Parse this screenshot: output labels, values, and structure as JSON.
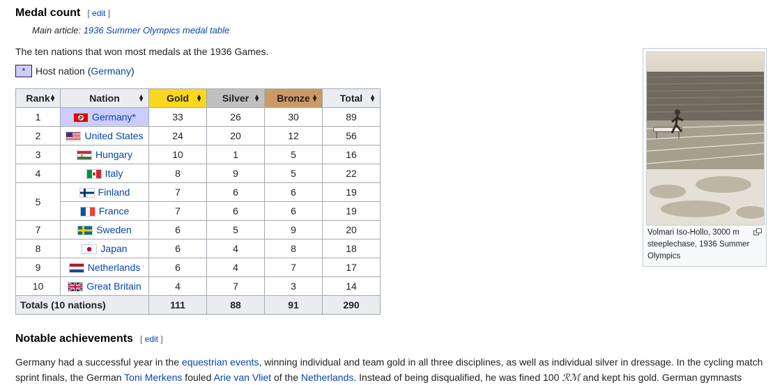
{
  "section1": {
    "title": "Medal count",
    "edit_open": "[",
    "edit_label": "edit",
    "edit_close": "]"
  },
  "hatnote": {
    "prefix": "Main article: ",
    "link": "1936 Summer Olympics medal table"
  },
  "intro": "The ten nations that won most medals at the 1936 Games.",
  "legend": {
    "symbol": "*",
    "text": "Host nation (",
    "link": "Germany",
    "close": ")"
  },
  "table": {
    "headers": [
      "Rank",
      "Nation",
      "Gold",
      "Silver",
      "Bronze",
      "Total"
    ],
    "rows": [
      {
        "rank": "1",
        "nation": "Germany*",
        "gold": "33",
        "silver": "26",
        "bronze": "30",
        "total": "89",
        "flag": "germany"
      },
      {
        "rank": "2",
        "nation": "United States",
        "gold": "24",
        "silver": "20",
        "bronze": "12",
        "total": "56",
        "flag": "usa"
      },
      {
        "rank": "3",
        "nation": "Hungary",
        "gold": "10",
        "silver": "1",
        "bronze": "5",
        "total": "16",
        "flag": "hungary"
      },
      {
        "rank": "4",
        "nation": "Italy",
        "gold": "8",
        "silver": "9",
        "bronze": "5",
        "total": "22",
        "flag": "italy"
      },
      {
        "rank": "5",
        "nation": "Finland",
        "gold": "7",
        "silver": "6",
        "bronze": "6",
        "total": "19",
        "flag": "finland"
      },
      {
        "rank": "",
        "nation": "France",
        "gold": "7",
        "silver": "6",
        "bronze": "6",
        "total": "19",
        "flag": "france"
      },
      {
        "rank": "7",
        "nation": "Sweden",
        "gold": "6",
        "silver": "5",
        "bronze": "9",
        "total": "20",
        "flag": "sweden"
      },
      {
        "rank": "8",
        "nation": "Japan",
        "gold": "6",
        "silver": "4",
        "bronze": "8",
        "total": "18",
        "flag": "japan"
      },
      {
        "rank": "9",
        "nation": "Netherlands",
        "gold": "6",
        "silver": "4",
        "bronze": "7",
        "total": "17",
        "flag": "netherlands"
      },
      {
        "rank": "10",
        "nation": "Great Britain",
        "gold": "4",
        "silver": "7",
        "bronze": "3",
        "total": "14",
        "flag": "uk"
      }
    ],
    "totals": {
      "label": "Totals (10 nations)",
      "gold": "111",
      "silver": "88",
      "bronze": "91",
      "total": "290"
    },
    "colors": {
      "gold": "#f9d71c",
      "silver": "#c0c0c0",
      "bronze": "#cc9966",
      "host": "#ccccff"
    }
  },
  "figure": {
    "caption": "Volmari Iso-Hollo, 3000 m steeplechase, 1936 Summer Olympics",
    "icon": "magnify-icon"
  },
  "section2": {
    "title": "Notable achievements",
    "edit_open": "[",
    "edit_label": "edit",
    "edit_close": "]"
  },
  "paragraph": [
    {
      "t": "Germany had a successful year in the "
    },
    {
      "t": "equestrian events",
      "link": true
    },
    {
      "t": ", winning individual and team gold in all three disciplines, as well as individual silver in dressage. In the cycling match sprint finals, the German "
    },
    {
      "t": "Toni Merkens",
      "link": true
    },
    {
      "t": " fouled "
    },
    {
      "t": "Arie van Vliet",
      "link": true
    },
    {
      "t": " of the "
    },
    {
      "t": "Netherlands",
      "link": true
    },
    {
      "t": ". Instead of being disqualified, he was fined 100 "
    },
    {
      "t": "ℛℳ",
      "script": true
    },
    {
      "t": " and kept his gold. German gymnasts"
    }
  ]
}
